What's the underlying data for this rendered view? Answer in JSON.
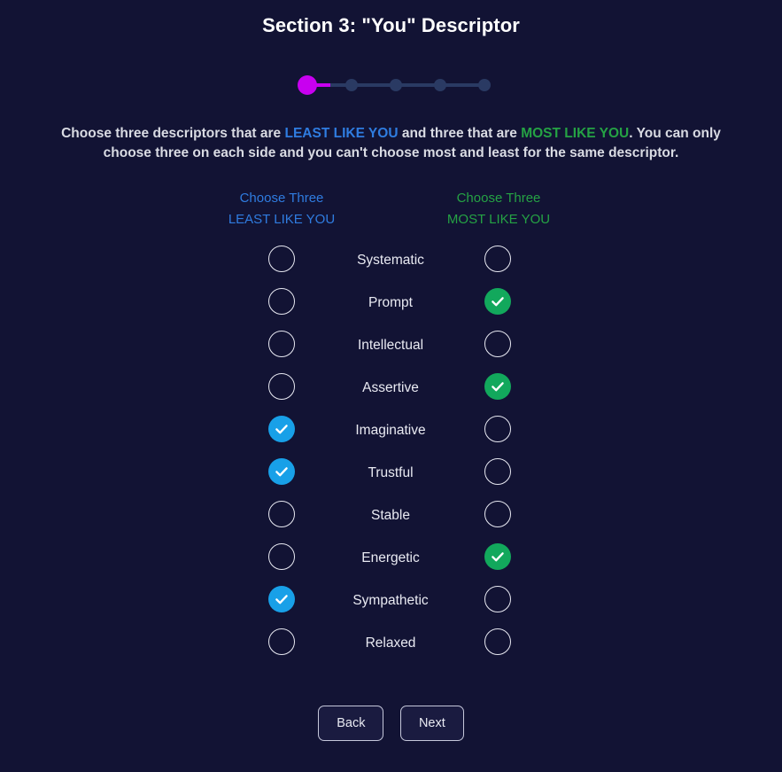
{
  "page": {
    "title": "Section 3: \"You\" Descriptor",
    "background_color": "#121334"
  },
  "progress": {
    "total_steps": 5,
    "current_step": 1,
    "active_color": "#c800f0",
    "inactive_color": "#2a3a63"
  },
  "instructions": {
    "part1": "Choose three descriptors that are ",
    "least_highlight": "LEAST LIKE YOU",
    "part2": " and three that are ",
    "most_highlight": "MOST LIKE YOU",
    "part3": ". You can only choose three on each side and you can't choose most and least for the same descriptor.",
    "least_color": "#2f7ce0",
    "most_color": "#25a244"
  },
  "columns": {
    "left": {
      "line1": "Choose Three",
      "line2": "LEAST LIKE YOU",
      "color": "#2f7ce0",
      "checked_color": "#18a0e8"
    },
    "right": {
      "line1": "Choose Three",
      "line2": "MOST LIKE YOU",
      "color": "#25a244",
      "checked_color": "#12a85c"
    }
  },
  "descriptors": [
    {
      "label": "Systematic",
      "least_selected": false,
      "most_selected": false
    },
    {
      "label": "Prompt",
      "least_selected": false,
      "most_selected": true
    },
    {
      "label": "Intellectual",
      "least_selected": false,
      "most_selected": false
    },
    {
      "label": "Assertive",
      "least_selected": false,
      "most_selected": true
    },
    {
      "label": "Imaginative",
      "least_selected": true,
      "most_selected": false
    },
    {
      "label": "Trustful",
      "least_selected": true,
      "most_selected": false
    },
    {
      "label": "Stable",
      "least_selected": false,
      "most_selected": false
    },
    {
      "label": "Energetic",
      "least_selected": false,
      "most_selected": true
    },
    {
      "label": "Sympathetic",
      "least_selected": true,
      "most_selected": false
    },
    {
      "label": "Relaxed",
      "least_selected": false,
      "most_selected": false
    }
  ],
  "buttons": {
    "back": "Back",
    "next": "Next"
  }
}
